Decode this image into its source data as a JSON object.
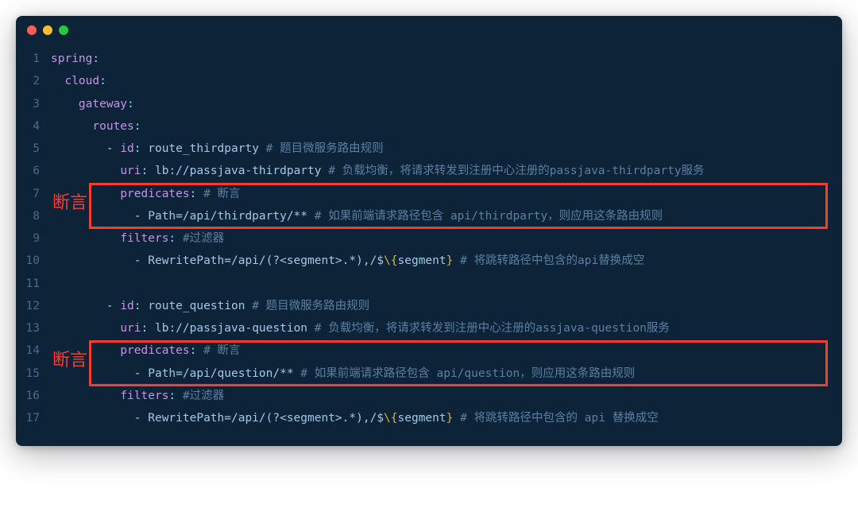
{
  "window": {
    "dots": [
      "red",
      "yellow",
      "green"
    ]
  },
  "annotations": {
    "label1": "断言",
    "label2": "断言"
  },
  "lines": {
    "l1_key": "spring",
    "l2_key": "cloud",
    "l3_key": "gateway",
    "l4_key": "routes",
    "l5_id": "id",
    "l5_val": "route_thirdparty",
    "l5_comment": "# 题目微服务路由规则",
    "l6_uri": "uri",
    "l6_val": "lb://passjava-thirdparty",
    "l6_comment": "# 负载均衡，将请求转发到注册中心注册的passjava-thirdparty服务",
    "l7_key": "predicates",
    "l7_comment": "# 断言",
    "l8_val": "Path=/api/thirdparty/**",
    "l8_comment": "# 如果前端请求路径包含 api/thirdparty，则应用这条路由规则",
    "l9_key": "filters",
    "l9_comment": "#过滤器",
    "l10_val_a": "RewritePath=/api/(?<segment>.*),/$",
    "l10_val_b": "\\{",
    "l10_val_c": "segment",
    "l10_val_d": "}",
    "l10_comment": "# 将跳转路径中包含的api替换成空",
    "l12_id": "id",
    "l12_val": "route_question",
    "l12_comment": "# 题目微服务路由规则",
    "l13_uri": "uri",
    "l13_val": "lb://passjava-question",
    "l13_comment": "# 负载均衡，将请求转发到注册中心注册的assjava-question服务",
    "l14_key": "predicates",
    "l14_comment": "# 断言",
    "l15_val": "Path=/api/question/**",
    "l15_comment": "# 如果前端请求路径包含 api/question，则应用这条路由规则",
    "l16_key": "filters",
    "l16_comment": "#过滤器",
    "l17_val_a": "RewritePath=/api/(?<segment>.*),/$",
    "l17_val_b": "\\{",
    "l17_val_c": "segment",
    "l17_val_d": "}",
    "l17_comment": "# 将跳转路径中包含的 api 替换成空"
  }
}
